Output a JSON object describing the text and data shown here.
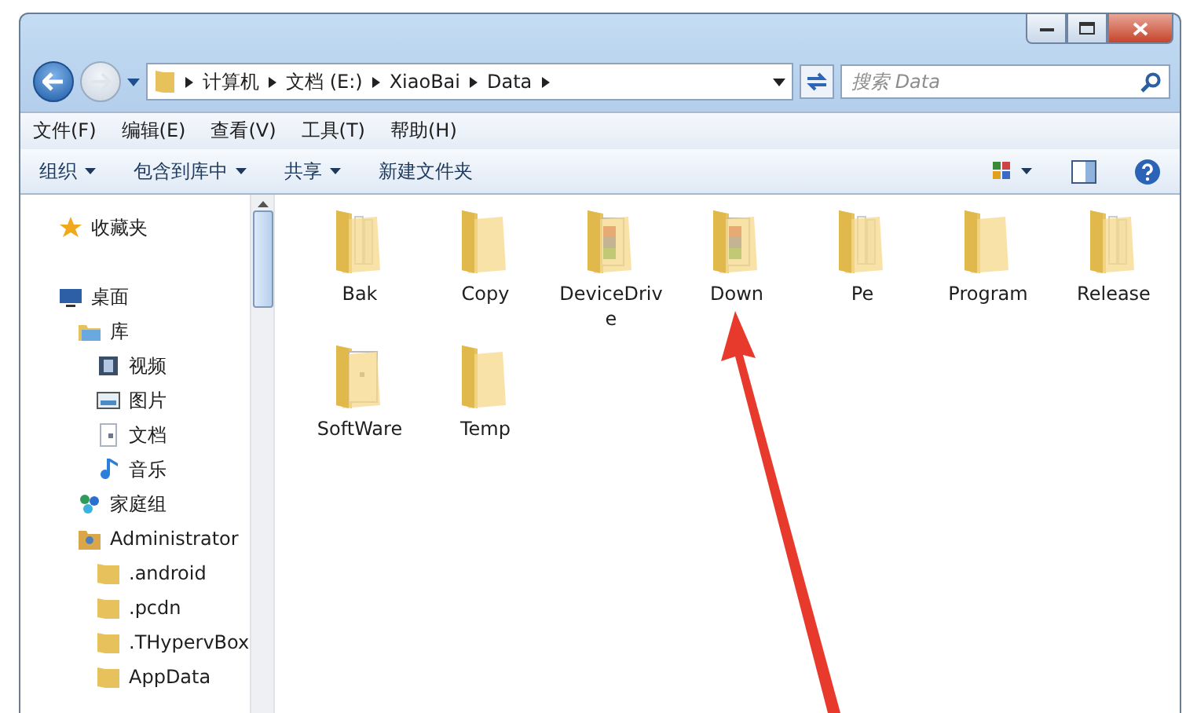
{
  "window": {
    "buttons": [
      {
        "kind": "minimize"
      },
      {
        "kind": "maximize"
      },
      {
        "kind": "close"
      }
    ]
  },
  "address_bar": {
    "path": [
      "计算机",
      "文档 (E:)",
      "XiaoBai",
      "Data"
    ]
  },
  "search": {
    "placeholder": "搜索 Data"
  },
  "menu_bar": [
    "文件(F)",
    "编辑(E)",
    "查看(V)",
    "工具(T)",
    "帮助(H)"
  ],
  "command_bar": [
    {
      "label": "组织",
      "dropdown": true
    },
    {
      "label": "包含到库中",
      "dropdown": true
    },
    {
      "label": "共享",
      "dropdown": true
    },
    {
      "label": "新建文件夹",
      "dropdown": false
    }
  ],
  "sidebar": {
    "items": [
      {
        "label": "收藏夹",
        "kind": "star"
      },
      {
        "label": "桌面",
        "kind": "desktop",
        "children": [
          {
            "label": "库",
            "kind": "library",
            "children": [
              {
                "label": "视频",
                "kind": "video"
              },
              {
                "label": "图片",
                "kind": "picture"
              },
              {
                "label": "文档",
                "kind": "document"
              },
              {
                "label": "音乐",
                "kind": "music"
              }
            ]
          },
          {
            "label": "家庭组",
            "kind": "homegroup"
          },
          {
            "label": "Administrator",
            "kind": "user",
            "children": [
              {
                "label": ".android",
                "kind": "folder"
              },
              {
                "label": ".pcdn",
                "kind": "folder"
              },
              {
                "label": ".THypervBox",
                "kind": "folder"
              },
              {
                "label": "AppData",
                "kind": "folder"
              }
            ]
          }
        ]
      }
    ]
  },
  "files": [
    {
      "name": "Bak",
      "kind": "papers"
    },
    {
      "name": "Copy",
      "kind": "plain"
    },
    {
      "name": "DeviceDrive",
      "kind": "archive"
    },
    {
      "name": "Down",
      "kind": "archive"
    },
    {
      "name": "Pe",
      "kind": "papers"
    },
    {
      "name": "Program",
      "kind": "plain"
    },
    {
      "name": "Release",
      "kind": "papers"
    },
    {
      "name": "SoftWare",
      "kind": "document"
    },
    {
      "name": "Temp",
      "kind": "plain"
    }
  ],
  "annotation": {
    "kind": "arrow"
  }
}
